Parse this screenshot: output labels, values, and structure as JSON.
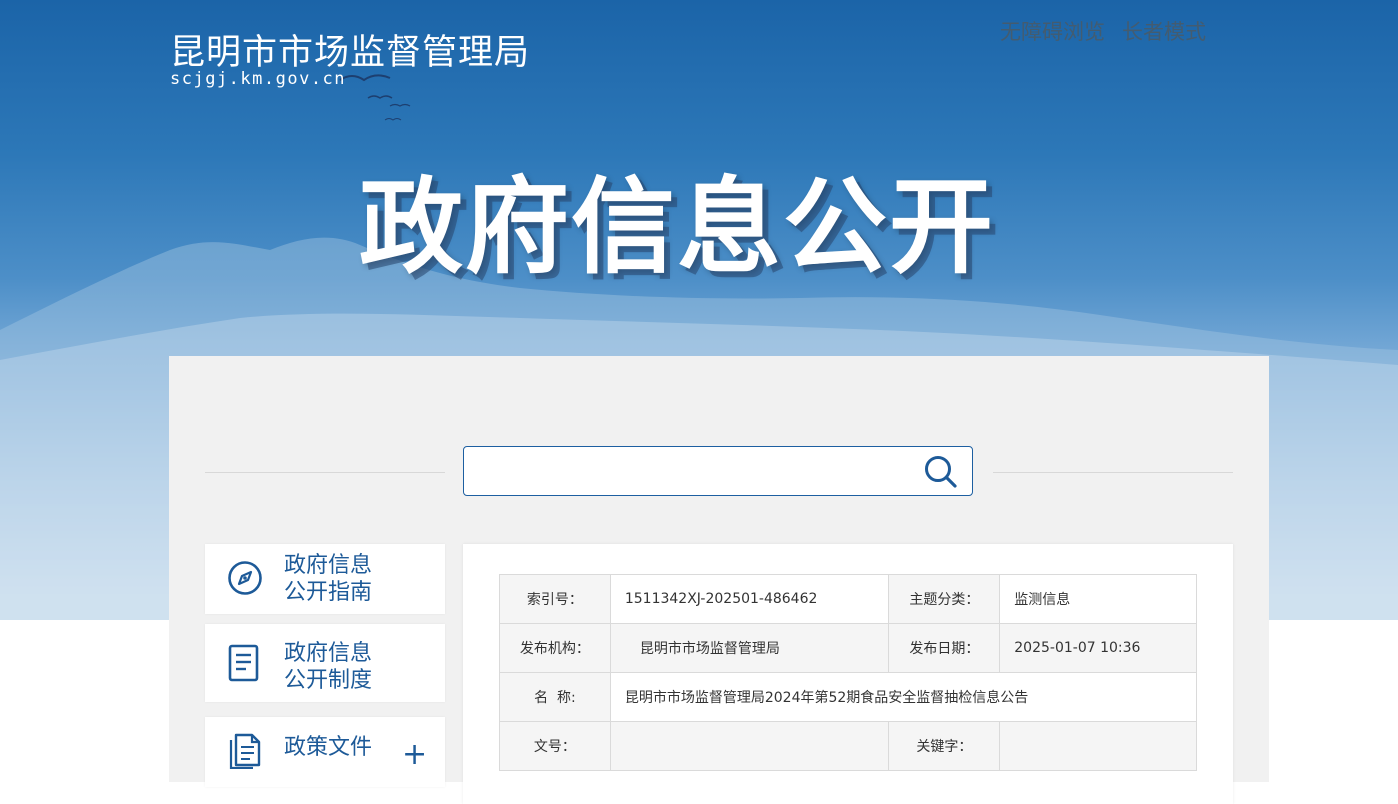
{
  "header": {
    "site_title": "昆明市市场监督管理局",
    "site_domain": "scjgj.km.gov.cn",
    "links": [
      "无障碍浏览",
      "长者模式"
    ],
    "hero_title": "政府信息公开"
  },
  "search": {
    "placeholder": "",
    "icon": "search-icon"
  },
  "sidebar": {
    "items": [
      {
        "label": "政府信息\n公开指南",
        "icon": "compass-icon"
      },
      {
        "label": "政府信息\n公开制度",
        "icon": "document-icon"
      },
      {
        "label": "政策文件",
        "icon": "files-icon",
        "expand": "+"
      }
    ]
  },
  "metadata": {
    "index_label": "索引号：",
    "index_value": "1511342XJ-202501-486462",
    "topic_label": "主题分类：",
    "topic_value": "监测信息",
    "publisher_label": "发布机构：",
    "publisher_value": "昆明市市场监督管理局",
    "date_label": "发布日期：",
    "date_value": "2025-01-07 10:36",
    "name_label": "名  称:",
    "name_value": "昆明市市场监督管理局2024年第52期食品安全监督抽检信息公告",
    "docno_label": "文号：",
    "docno_value": "",
    "keyword_label": "关键字：",
    "keyword_value": ""
  },
  "colors": {
    "brand_blue": "#1d5a98",
    "banner_top": "#1b64a8",
    "panel_bg": "#f1f1f1"
  }
}
